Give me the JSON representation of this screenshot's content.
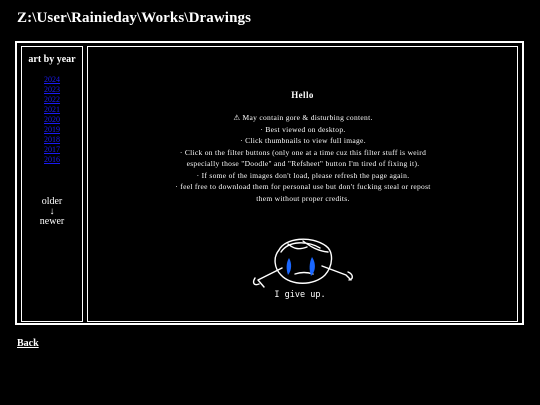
{
  "page": {
    "title": "Z:\\User\\Rainieday\\Works\\Drawings"
  },
  "sidebar": {
    "title": "art by year",
    "years": [
      "2024",
      "2023",
      "2022",
      "2021",
      "2020",
      "2019",
      "2018",
      "2017",
      "2016"
    ],
    "older_label": "older",
    "arrow": "↓",
    "newer_label": "newer"
  },
  "content": {
    "heading": "Hello",
    "notes": [
      "⚠ May contain gore & disturbing content.",
      "· Best viewed on desktop.",
      "· Click thumbnails to view full image.",
      "· Click on the filter buttons (only one at a time cuz this filter stuff is weird especially those \"Doodle\" and \"Refsheet\" button I'm tired of fixing it).",
      "· If some of the images don't load, please refresh the page again.",
      "· feel free to download them for personal use but don't fucking steal or repost them without proper credits."
    ],
    "doodle_caption": "I give up."
  },
  "footer": {
    "back_label": "Back"
  }
}
